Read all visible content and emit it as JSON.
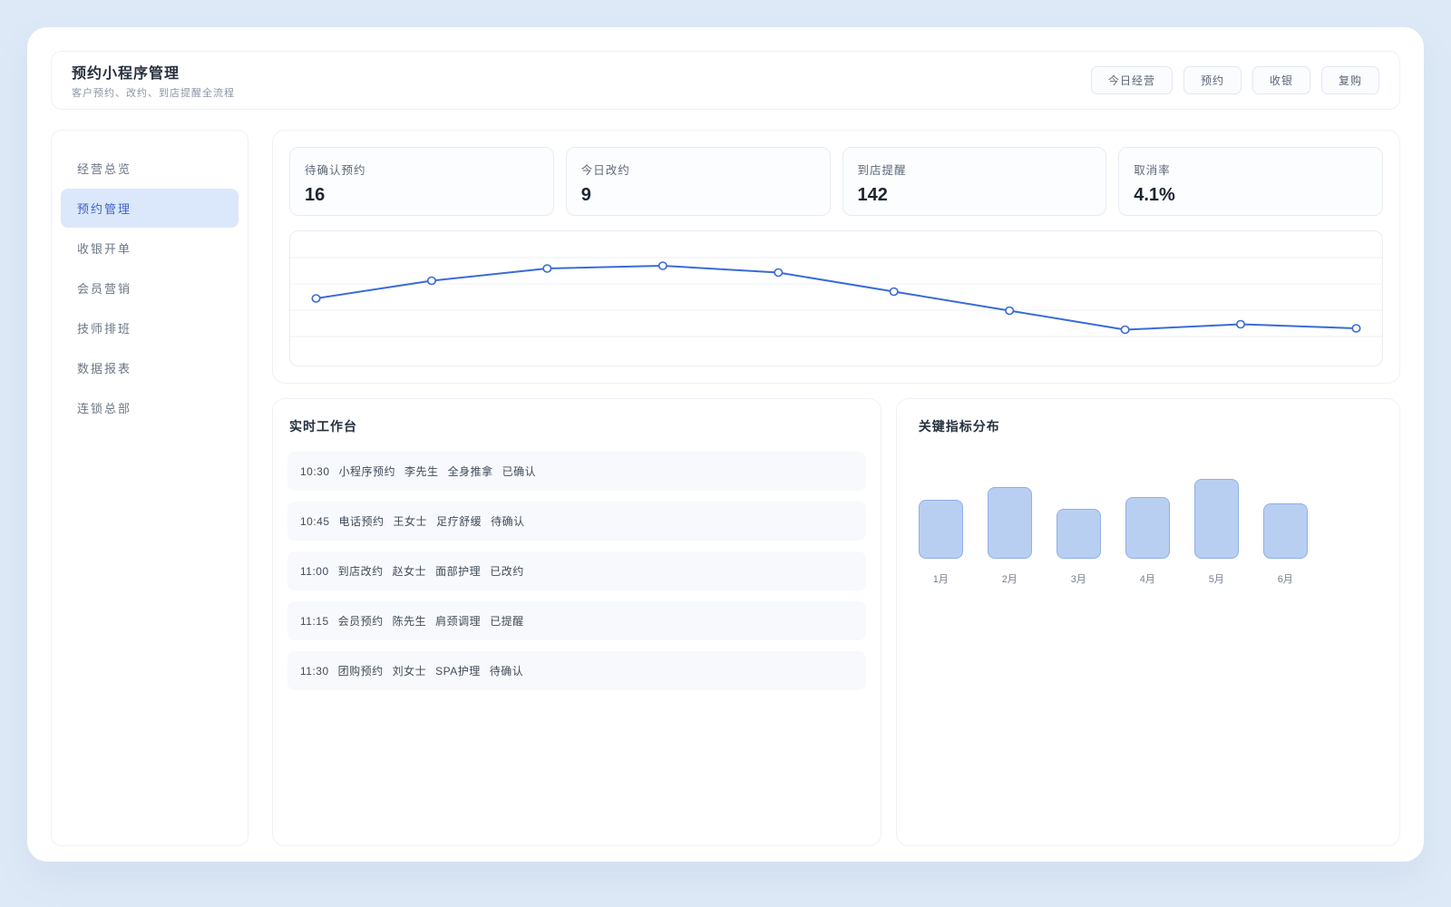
{
  "header": {
    "title": "预约小程序管理",
    "subtitle": "客户预约、改约、到店提醒全流程",
    "buttons": [
      "今日经营",
      "预约",
      "收银",
      "复购"
    ]
  },
  "sidebar": {
    "items": [
      {
        "label": "经营总览",
        "active": false
      },
      {
        "label": "预约管理",
        "active": true
      },
      {
        "label": "收银开单",
        "active": false
      },
      {
        "label": "会员营销",
        "active": false
      },
      {
        "label": "技师排班",
        "active": false
      },
      {
        "label": "数据报表",
        "active": false
      },
      {
        "label": "连锁总部",
        "active": false
      }
    ]
  },
  "stats": [
    {
      "label": "待确认预约",
      "value": "16"
    },
    {
      "label": "今日改约",
      "value": "9"
    },
    {
      "label": "到店提醒",
      "value": "142"
    },
    {
      "label": "取消率",
      "value": "4.1%"
    }
  ],
  "workbench": {
    "title": "实时工作台",
    "items": [
      {
        "time": "10:30",
        "channel": "小程序预约",
        "customer": "李先生",
        "service": "全身推拿",
        "status": "已确认"
      },
      {
        "time": "10:45",
        "channel": "电话预约",
        "customer": "王女士",
        "service": "足疗舒缓",
        "status": "待确认"
      },
      {
        "time": "11:00",
        "channel": "到店改约",
        "customer": "赵女士",
        "service": "面部护理",
        "status": "已改约"
      },
      {
        "time": "11:15",
        "channel": "会员预约",
        "customer": "陈先生",
        "service": "肩颈调理",
        "status": "已提醒"
      },
      {
        "time": "11:30",
        "channel": "团购预约",
        "customer": "刘女士",
        "service": "SPA护理",
        "status": "待确认"
      }
    ]
  },
  "indicators": {
    "title": "关键指标分布"
  },
  "colors": {
    "accent": "#3a6bd8",
    "bar_fill": "#b9cff2",
    "bar_border": "#8fb0e8",
    "active_item_bg": "#dbe7fa",
    "grid_line": "#eef2f7"
  },
  "chart_data": [
    {
      "type": "line",
      "title": "",
      "x": [
        1,
        2,
        3,
        4,
        5,
        6,
        7,
        8,
        9,
        10
      ],
      "values": [
        50,
        63,
        72,
        74,
        69,
        55,
        41,
        27,
        31,
        28
      ],
      "ylim": [
        0,
        100
      ],
      "color": "#3a6bd8",
      "grid": true,
      "markers": "circle-open"
    },
    {
      "type": "bar",
      "title": "关键指标分布",
      "categories": [
        "1月",
        "2月",
        "3月",
        "4月",
        "5月",
        "6月"
      ],
      "values": [
        65,
        79,
        55,
        68,
        88,
        61
      ],
      "ylim": [
        0,
        100
      ],
      "grid": false
    }
  ]
}
